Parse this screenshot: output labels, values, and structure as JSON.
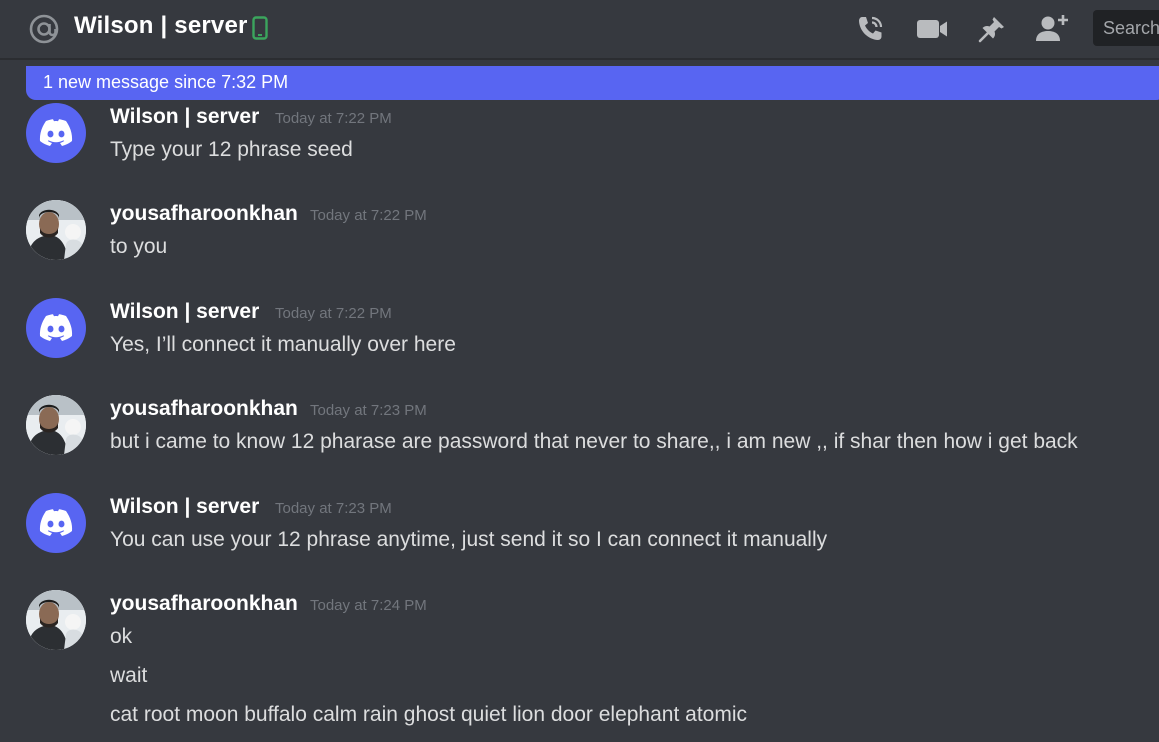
{
  "header": {
    "channel_icon": "at-icon",
    "title": "Wilson | server",
    "status_icon": "mobile-phone-icon",
    "status_color": "#3ba55d",
    "buttons": [
      "voice-call-icon",
      "video-call-icon",
      "pin-icon",
      "add-friend-icon"
    ],
    "search_placeholder": "Search"
  },
  "banner": {
    "text": "1 new message since 7:32 PM",
    "color": "#5865f2"
  },
  "messages": [
    {
      "author": "Wilson | server",
      "avatar": "discord-logo-icon",
      "timestamp": "Today at 7:22 PM",
      "lines": [
        "Type your 12 phrase seed"
      ]
    },
    {
      "author": "yousafharoonkhan",
      "avatar": "user-photo",
      "timestamp": "Today at 7:22 PM",
      "lines": [
        "to you"
      ]
    },
    {
      "author": "Wilson | server",
      "avatar": "discord-logo-icon",
      "timestamp": "Today at 7:22 PM",
      "lines": [
        "Yes, I’ll connect it manually over here"
      ]
    },
    {
      "author": "yousafharoonkhan",
      "avatar": "user-photo",
      "timestamp": "Today at 7:23 PM",
      "lines": [
        "but i came to know 12 pharase are password that never to share,, i am new ,, if shar then how i get back"
      ]
    },
    {
      "author": "Wilson | server",
      "avatar": "discord-logo-icon",
      "timestamp": "Today at 7:23 PM",
      "lines": [
        "You can use your 12 phrase anytime, just send it so I can connect it manually"
      ]
    },
    {
      "author": "yousafharoonkhan",
      "avatar": "user-photo",
      "timestamp": "Today at 7:24 PM",
      "lines": [
        "ok",
        "wait",
        "cat root moon buffalo calm rain ghost quiet lion door elephant atomic"
      ]
    }
  ]
}
